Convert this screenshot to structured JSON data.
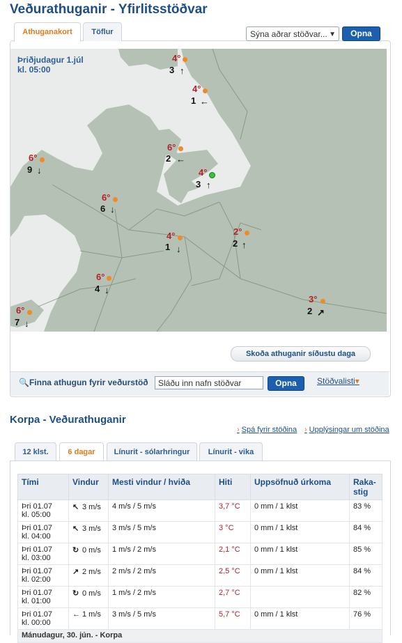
{
  "page": {
    "title": "Veðurathuganir - Yfirlitsstöðvar"
  },
  "map_tabs": [
    "Athuganakort",
    "Töflur"
  ],
  "station_select": {
    "value": "Sýna aðrar stöðvar..."
  },
  "open_button": "Opna",
  "map": {
    "date": "Þriðjudagur 1.júl",
    "time": "kl. 05:00",
    "stations": [
      {
        "temp": "4°",
        "wind": "3",
        "dir": "↑",
        "dot": "#f08a24"
      },
      {
        "temp": "4°",
        "wind": "1",
        "dir": "←",
        "dot": "#f08a24"
      },
      {
        "temp": "6°",
        "wind": "2",
        "dir": "←",
        "dot": "#f08a24"
      },
      {
        "temp": "6°",
        "wind": "9",
        "dir": "↓",
        "dot": "#f08a24"
      },
      {
        "temp": "4°",
        "wind": "3",
        "dir": "↑",
        "dot": "#3ac23a"
      },
      {
        "temp": "6°",
        "wind": "6",
        "dir": "↓",
        "dot": "#f08a24"
      },
      {
        "temp": "4°",
        "wind": "1",
        "dir": "↓",
        "dot": "#f08a24"
      },
      {
        "temp": "2°",
        "wind": "2",
        "dir": "↑",
        "dot": "#f08a24"
      },
      {
        "temp": "6°",
        "wind": "4",
        "dir": "↓",
        "dot": "#f08a24"
      },
      {
        "temp": "6°",
        "wind": "7",
        "dir": "↓",
        "dot": "#f08a24"
      },
      {
        "temp": "3°",
        "wind": "2",
        "dir": "↗",
        "dot": "#f08a24"
      }
    ],
    "recent_button": "Skoða athuganir síðustu daga"
  },
  "find": {
    "label": "Finna athugun fyrir veðurstöð",
    "placeholder": "Sláðu inn nafn stöðvar",
    "button": "Opna",
    "list_link": "Stöðvalisti"
  },
  "station_section": {
    "title": "Korpa - Veðurathuganir",
    "links": [
      "Spá fyrir stöðina",
      "Upplýsingar um stöðina"
    ],
    "tabs": [
      "12 klst.",
      "6 dagar",
      "Línurit - sólarhringur",
      "Línurit - vika"
    ],
    "table": {
      "headers": [
        "Tími",
        "Vindur",
        "Mesti vindur / hviða",
        "Hiti",
        "Uppsöfnuð úrkoma",
        "Raka-stig"
      ],
      "rows": [
        {
          "time1": "Þri 01.07",
          "time2": "kl. 05:00",
          "dir": "↖",
          "wind": "3 m/s",
          "gust": "4 m/s  /  5 m/s",
          "temp": "3,7 °C",
          "rain": "0 mm / 1 klst",
          "hum": "83 %"
        },
        {
          "time1": "Þri 01.07",
          "time2": "kl. 04:00",
          "dir": "↖",
          "wind": "3 m/s",
          "gust": "3 m/s  /  5 m/s",
          "temp": "3 °C",
          "rain": "0 mm / 1 klst",
          "hum": "84 %"
        },
        {
          "time1": "Þri 01.07",
          "time2": "kl. 03:00",
          "dir": "↻",
          "wind": "0 m/s",
          "gust": "1 m/s  /  2 m/s",
          "temp": "2,1 °C",
          "rain": "0 mm / 1 klst",
          "hum": "85 %"
        },
        {
          "time1": "Þri 01.07",
          "time2": "kl. 02:00",
          "dir": "↗",
          "wind": "2 m/s",
          "gust": "2 m/s  /  2 m/s",
          "temp": "2,5 °C",
          "rain": "0 mm / 1 klst",
          "hum": "84 %"
        },
        {
          "time1": "Þri 01.07",
          "time2": "kl. 01:00",
          "dir": "↻",
          "wind": "0 m/s",
          "gust": "1 m/s  /  2 m/s",
          "temp": "2,7 °C",
          "rain": "",
          "hum": "82 %"
        },
        {
          "time1": "Þri 01.07",
          "time2": "kl. 00:00",
          "dir": "←",
          "wind": "1 m/s",
          "gust": "3 m/s  /  5 m/s",
          "temp": "5,7 °C",
          "rain": "0 mm / 1 klst",
          "hum": "76 %"
        }
      ],
      "separator": "Mánudagur, 30. jún. - Korpa"
    }
  }
}
